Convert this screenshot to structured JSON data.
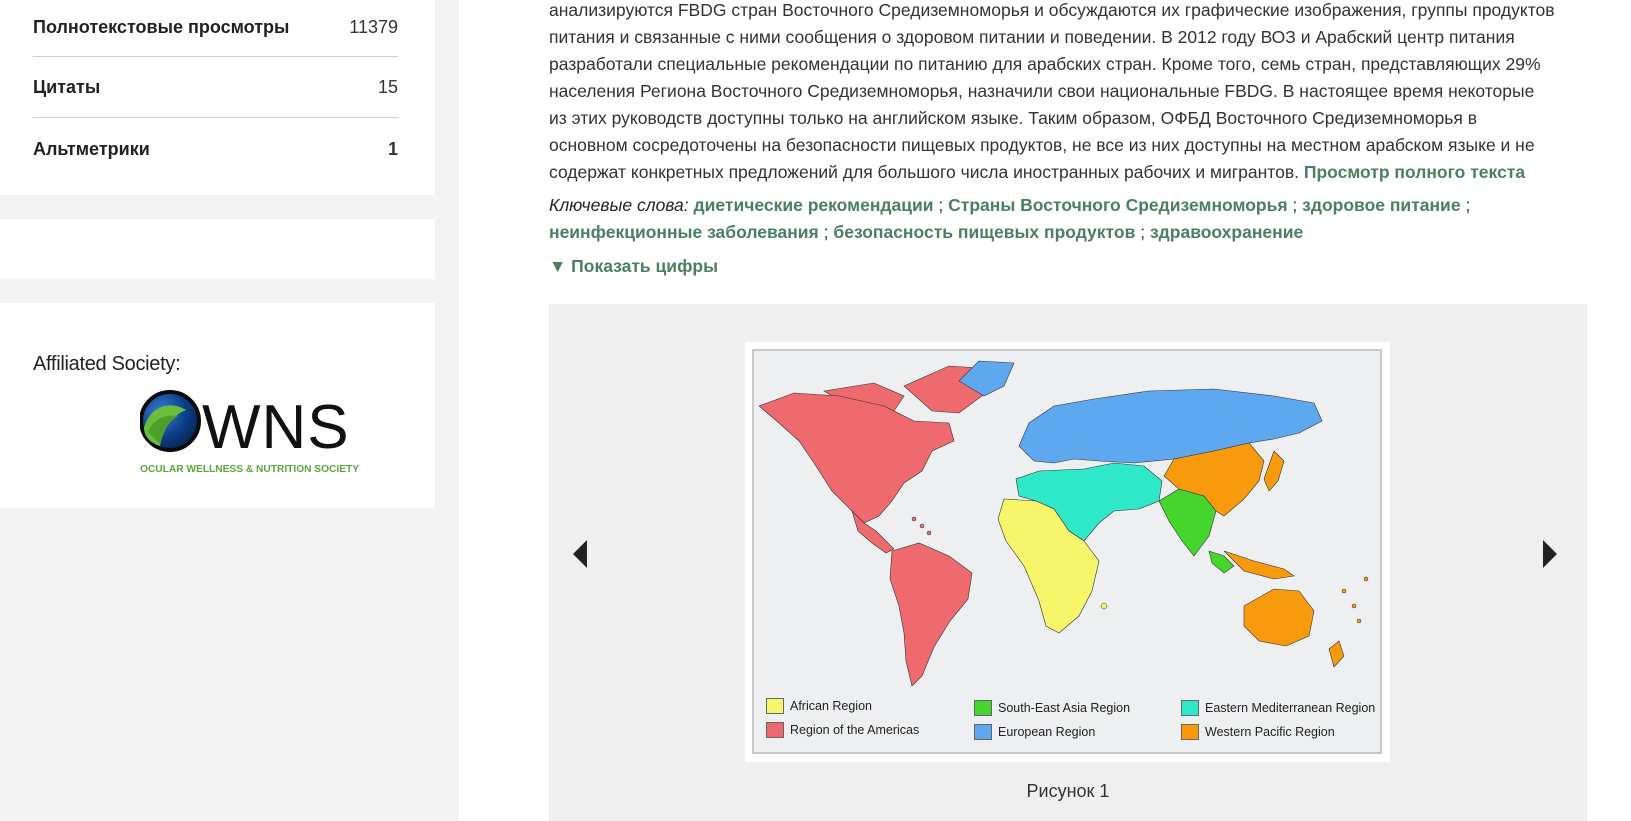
{
  "sidebar": {
    "metrics": [
      {
        "label": "Полнотекстовые просмотры",
        "value": "11379"
      },
      {
        "label": "Цитаты",
        "value": "15"
      },
      {
        "label": "Альтметрики",
        "value": "1"
      }
    ],
    "society_title": "Affiliated Society:",
    "logo_letters": "WNS",
    "logo_subtitle": "OCULAR WELLNESS & NUTRITION SOCIETY"
  },
  "abstract": {
    "lines": [
      "анализируются FBDG стран Восточного Средиземноморья и обсуждаются их графические изображения, группы продуктов",
      "питания и связанные с ними сообщения о здоровом питании и поведении. В 2012 году ВОЗ и Арабский центр питания",
      "разработали специальные рекомендации по питанию для арабских стран. Кроме того, семь стран, представляющих 29%",
      "населения Региона Восточного Средиземноморья, назначили свои национальные FBDG. В настоящее время некоторые",
      "из этих руководств доступны только на английском языке. Таким образом, ОФБД Восточного Средиземноморья в",
      "основном сосредоточены на безопасности пищевых продуктов, не все из них доступны на местном арабском языке и не",
      "содержат конкретных предложений для большого числа иностранных рабочих и мигрантов."
    ],
    "full_text_link": "Просмотр полного текста"
  },
  "keywords": {
    "label": "Ключевые слова:",
    "items": [
      "диетические рекомендации",
      "Страны Восточного Средиземноморья",
      "здоровое питание",
      "неинфекционные заболевания",
      "безопасность пищевых продуктов",
      "здравоохранение"
    ],
    "separator": ";"
  },
  "toggle": {
    "label": "▼ Показать цифры"
  },
  "figure": {
    "caption": "Рисунок 1",
    "legend": [
      {
        "label": "African Region",
        "color": "#f7f56a"
      },
      {
        "label": "Region of the Americas",
        "color": "#ee6a6e"
      },
      {
        "label": "South-East Asia Region",
        "color": "#44d62c"
      },
      {
        "label": "European Region",
        "color": "#5ea8f0"
      },
      {
        "label": "Eastern Mediterranean Region",
        "color": "#2ee8c8"
      },
      {
        "label": "Western Pacific Region",
        "color": "#f99a0c"
      }
    ]
  },
  "colors": {
    "link": "#4a7f62",
    "background": "#f3f3f3"
  }
}
